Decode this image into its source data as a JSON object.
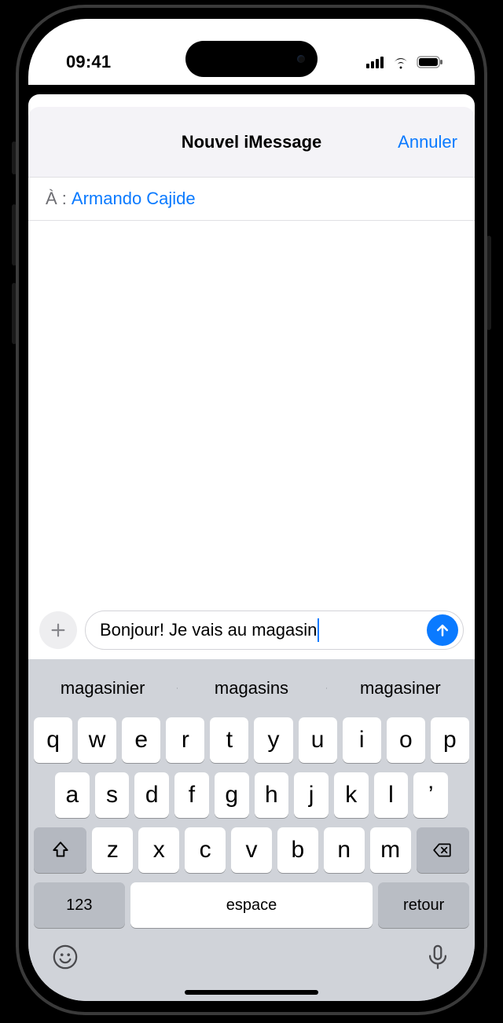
{
  "statusbar": {
    "time": "09:41"
  },
  "nav": {
    "title": "Nouvel iMessage",
    "cancel": "Annuler"
  },
  "to": {
    "label": "À :",
    "name": "Armando Cajide"
  },
  "compose": {
    "text": "Bonjour! Je vais au magasin"
  },
  "suggestions": [
    "magasinier",
    "magasins",
    "magasiner"
  ],
  "keyboard": {
    "row1": [
      "q",
      "w",
      "e",
      "r",
      "t",
      "y",
      "u",
      "i",
      "o",
      "p"
    ],
    "row2": [
      "a",
      "s",
      "d",
      "f",
      "g",
      "h",
      "j",
      "k",
      "l",
      "’"
    ],
    "row3": [
      "z",
      "x",
      "c",
      "v",
      "b",
      "n",
      "m"
    ],
    "numKey": "123",
    "space": "espace",
    "ret": "retour"
  }
}
